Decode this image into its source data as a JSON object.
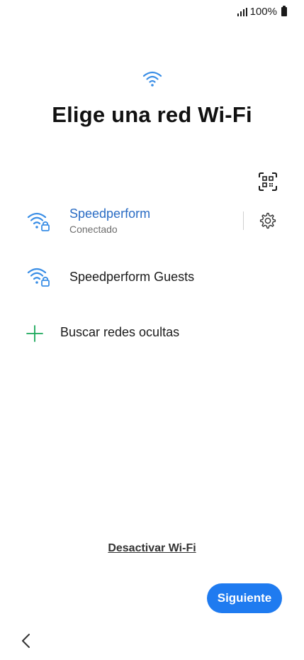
{
  "status_bar": {
    "signal_icon": "signal-bars-icon",
    "battery_text": "100%",
    "battery_icon": "battery-icon"
  },
  "header": {
    "icon": "wifi-icon",
    "title": "Elige una red Wi-Fi"
  },
  "qr_scan": {
    "icon": "qr-code-scan-icon"
  },
  "networks": [
    {
      "name": "Speedperform",
      "status": "Conectado",
      "icon": "wifi-lock-icon",
      "settings_icon": "gear-icon"
    },
    {
      "name": "Speedperform Guests",
      "icon": "wifi-lock-icon"
    }
  ],
  "add_network": {
    "icon": "plus-icon",
    "label": "Buscar redes ocultas"
  },
  "footer": {
    "disable_wifi_label": "Desactivar Wi-Fi",
    "next_label": "Siguiente",
    "back_icon": "chevron-left-icon"
  },
  "colors": {
    "accent_blue": "#2a6cc4",
    "button_blue": "#1f7bf0",
    "plus_green": "#1aa85a",
    "wifi_icon_blue": "#3a8ee6"
  }
}
